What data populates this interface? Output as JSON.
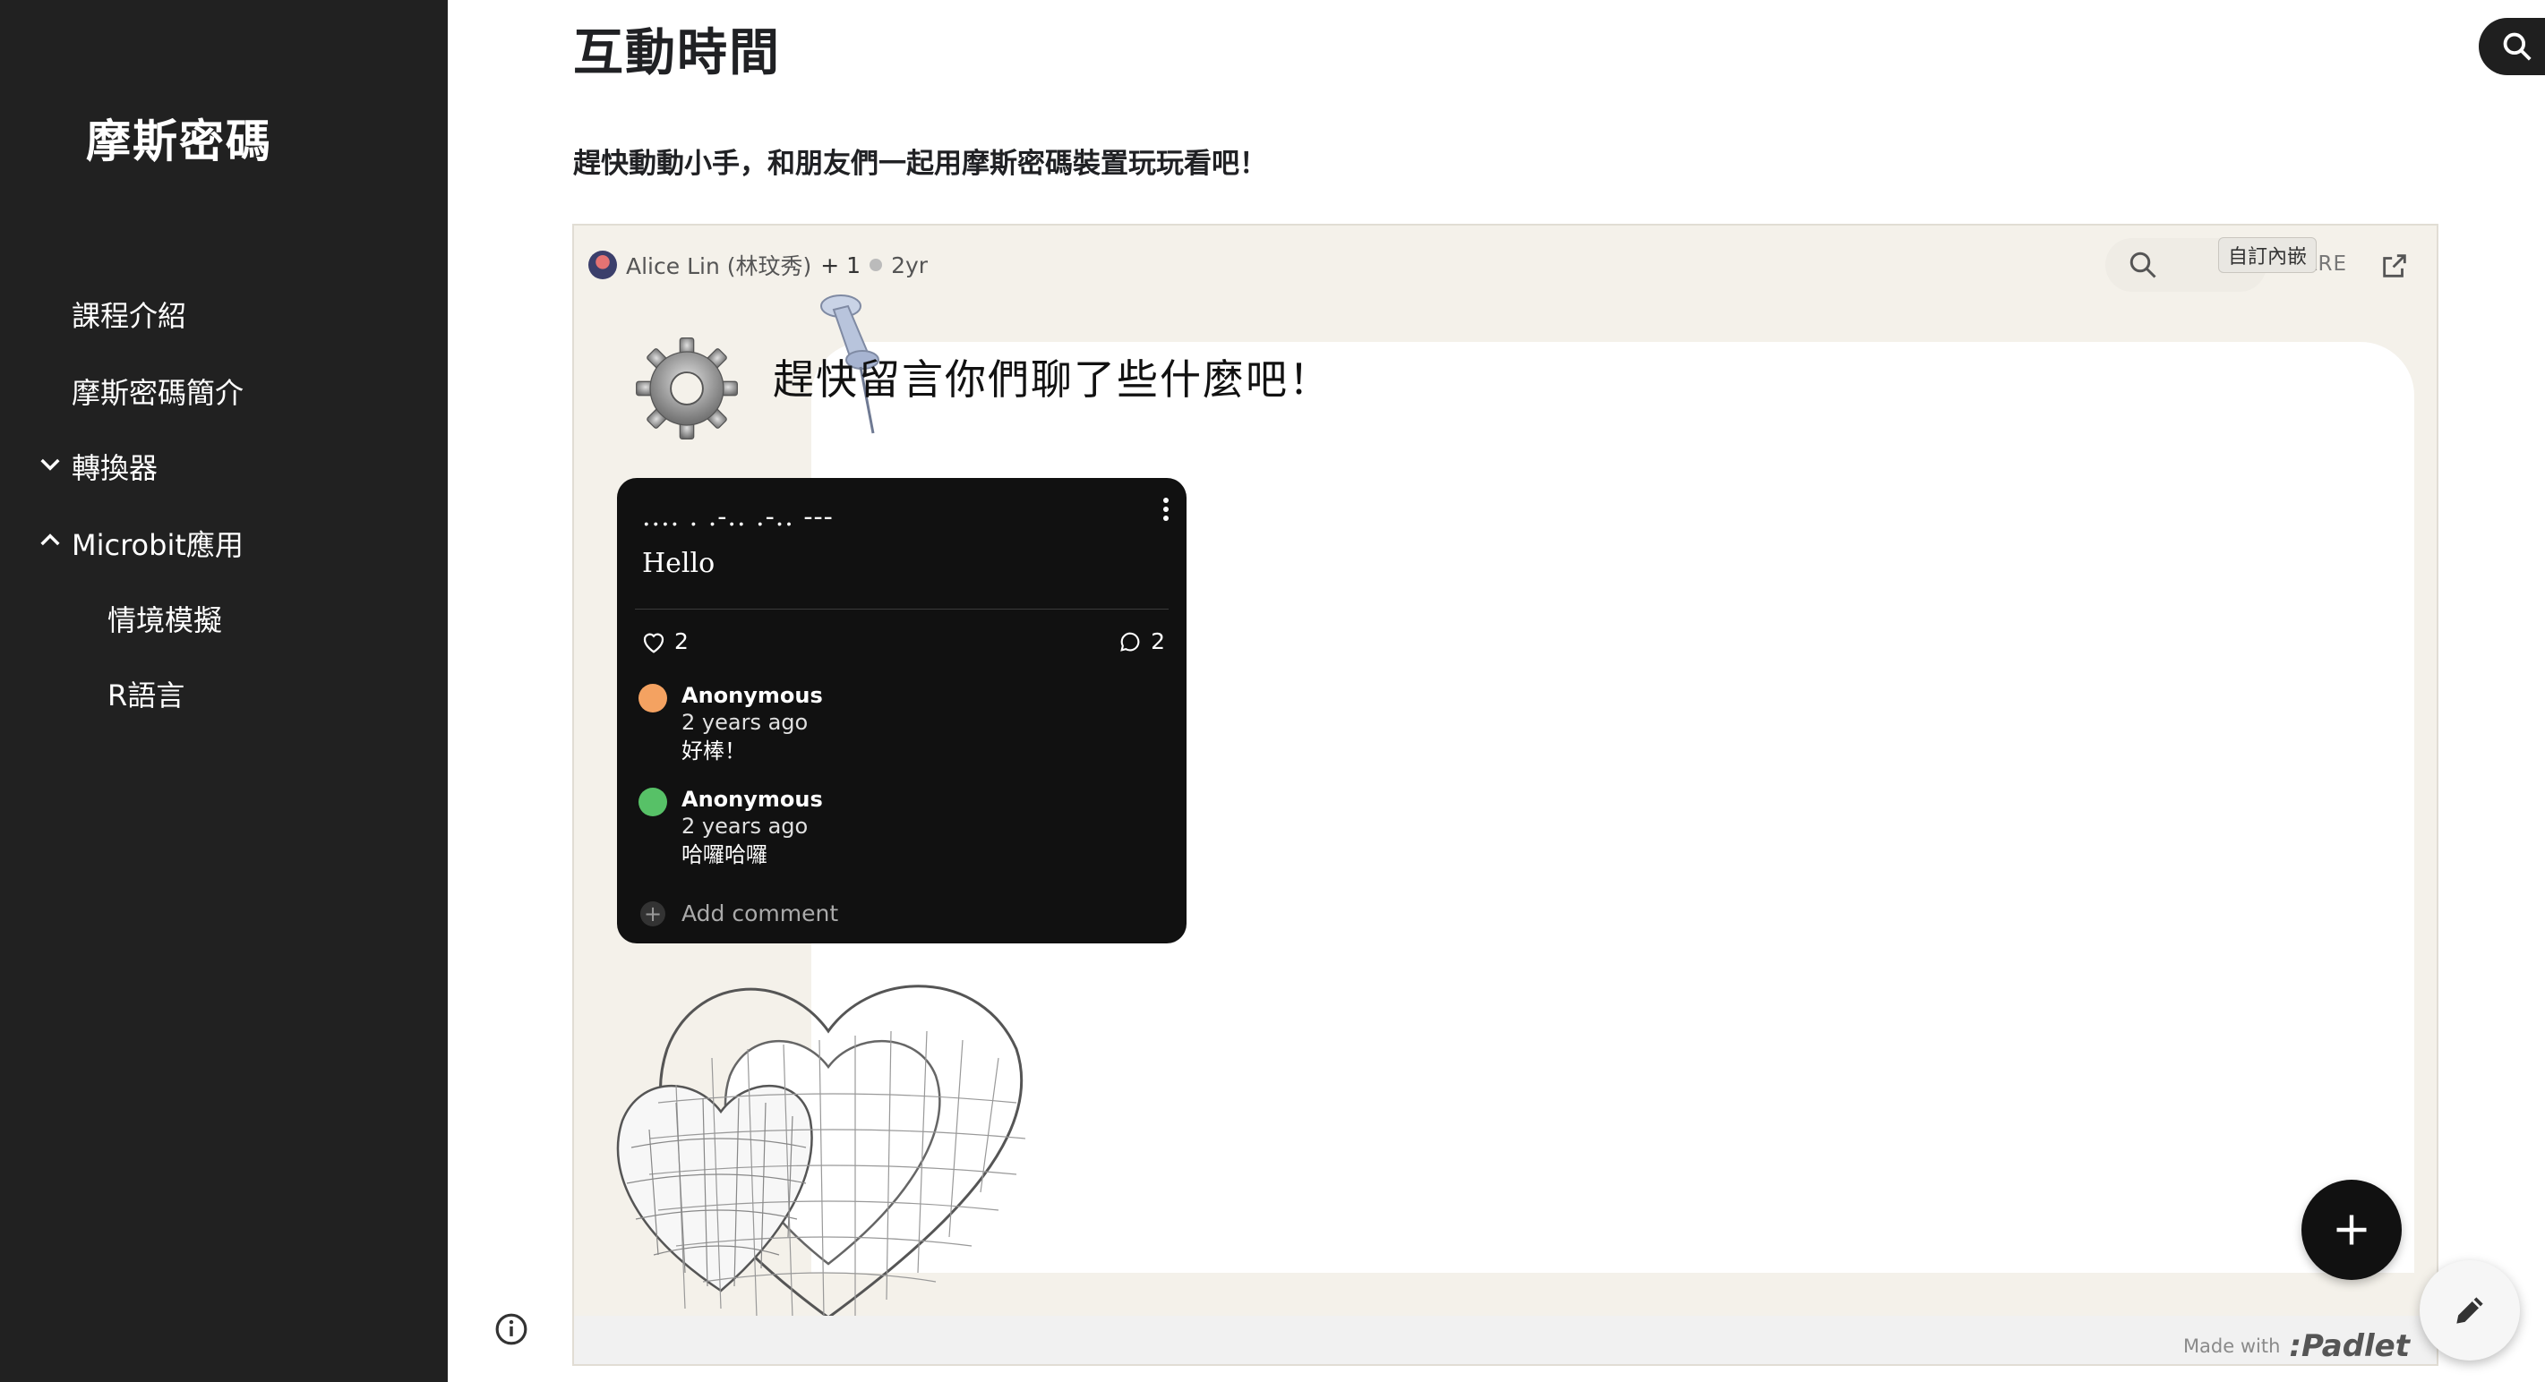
{
  "sidebar": {
    "site_title": "摩斯密碼",
    "items": [
      {
        "label": "課程介紹"
      },
      {
        "label": "摩斯密碼簡介"
      },
      {
        "label": "轉換器",
        "expanded": false
      },
      {
        "label": "Microbit應用",
        "expanded": true
      },
      {
        "label": "情境模擬"
      },
      {
        "label": "R語言"
      }
    ]
  },
  "main": {
    "title": "互動時間",
    "description": "趕快動動小手，和朋友們一起用摩斯密碼裝置玩玩看吧！"
  },
  "padlet": {
    "author": "Alice Lin (林玟秀)",
    "collaborators": "+ 1",
    "age": "2yr",
    "share_label": "SHARE",
    "tooltip": "自訂內嵌",
    "board_title": "趕快留言你們聊了些什麼吧！",
    "made_with": "Made with",
    "brand": ":Padlet",
    "post": {
      "subject": ".... . .-.. .-.. ---",
      "body": "Hello",
      "likes": "2",
      "comments_count": "2",
      "comments": [
        {
          "author": "Anonymous",
          "time": "2 years ago",
          "text": "好棒！",
          "avatar_color": "#f4a261"
        },
        {
          "author": "Anonymous",
          "time": "2 years ago",
          "text": "哈囉哈囉",
          "avatar_color": "#57c167"
        }
      ],
      "add_comment": "Add comment"
    }
  },
  "icons": {
    "search": "search-icon",
    "external": "external-link-icon",
    "add": "plus-icon",
    "edit": "pencil-icon",
    "info": "info-icon"
  }
}
